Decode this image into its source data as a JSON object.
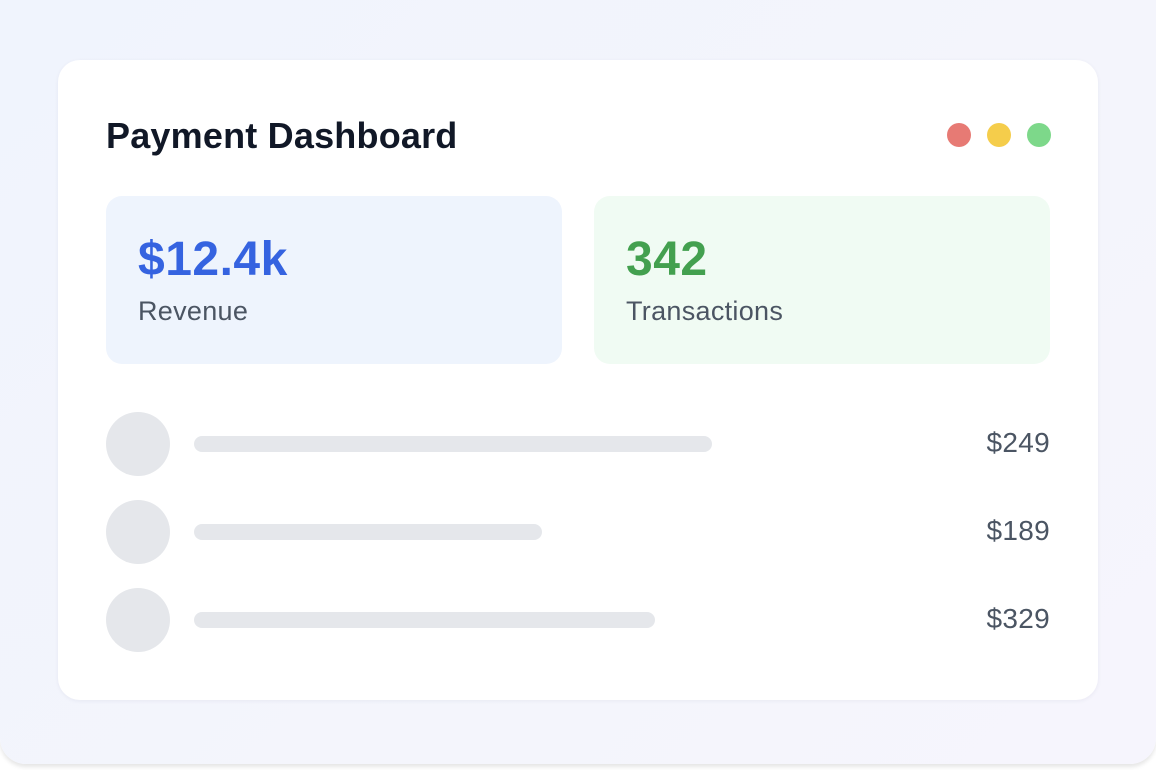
{
  "dashboard": {
    "title": "Payment Dashboard",
    "window_controls": [
      {
        "name": "close-dot",
        "color": "#e77a74"
      },
      {
        "name": "minimize-dot",
        "color": "#f5cd4b"
      },
      {
        "name": "maximize-dot",
        "color": "#7dd88a"
      }
    ]
  },
  "stats": {
    "revenue": {
      "value": "$12.4k",
      "label": "Revenue",
      "color": "#3563e0",
      "background": "#eef4fd"
    },
    "transactions": {
      "value": "342",
      "label": "Transactions",
      "color": "#43a04f",
      "background": "#f0fbf3"
    }
  },
  "transactions": [
    {
      "amount": "$249",
      "placeholder_fill": 0.605
    },
    {
      "amount": "$189",
      "placeholder_fill": 0.407
    },
    {
      "amount": "$329",
      "placeholder_fill": 0.538
    }
  ]
}
